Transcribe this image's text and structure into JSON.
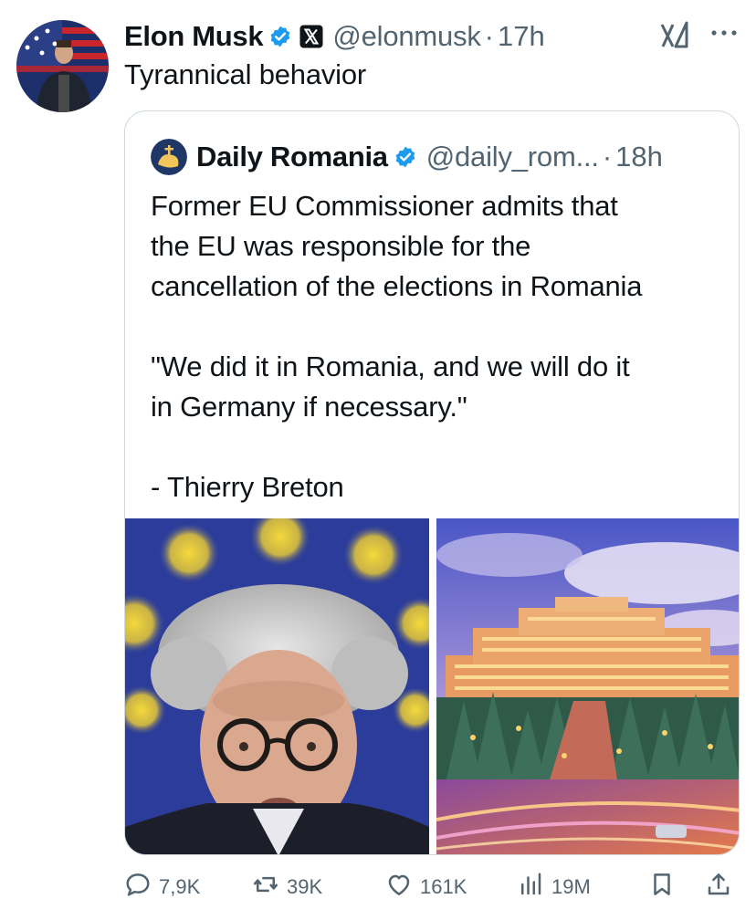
{
  "tweet": {
    "author_name": "Elon Musk",
    "handle": "@elonmusk",
    "separator": "·",
    "time": "17h",
    "text": "Tyrannical behavior",
    "avatar_icon": "person-avatar",
    "verified_icon": "verified-badge-icon",
    "affiliation_icon": "x-logo-icon"
  },
  "quote": {
    "author_name": "Daily Romania",
    "handle": "@daily_rom...",
    "separator": "·",
    "time": "18h",
    "lines": [
      "Former EU Commissioner admits that",
      "the EU was responsible for the",
      "cancellation of the elections in Romania",
      "",
      "\"We did it in Romania, and we will do it",
      "in Germany if necessary.\"",
      "",
      "- Thierry Breton"
    ],
    "media": [
      "portrait-photo",
      "palace-photo"
    ]
  },
  "actions": {
    "replies": "7,9K",
    "reposts": "39K",
    "likes": "161K",
    "views": "19M"
  },
  "colors": {
    "text": "#0f1419",
    "secondary": "#536471",
    "verified": "#1d9bf0",
    "border": "#cfd9de"
  }
}
